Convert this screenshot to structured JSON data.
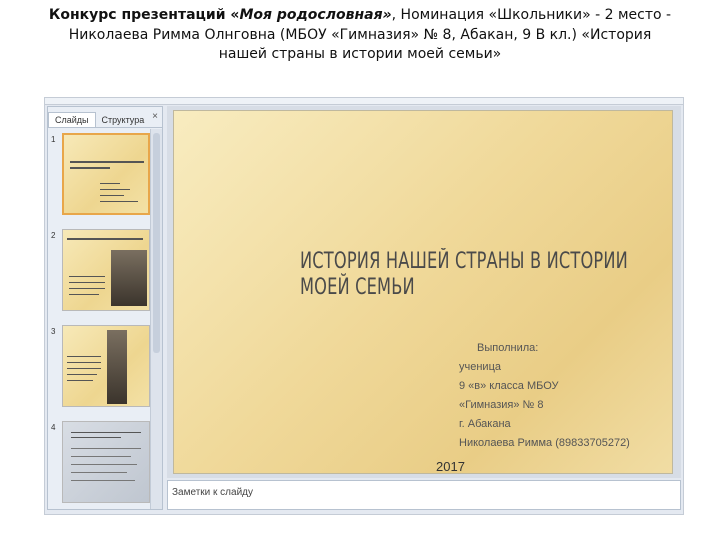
{
  "header": {
    "line1_bold": "Конкурс презентаций «",
    "line1_italic": "Моя родословная»",
    "line1_rest": ", Номинация «Школьники» - 2 место -",
    "line2": "Николаева Римма Олнговна (МБОУ «Гимназия» № 8, Абакан, 9 В кл.) «История",
    "line3": "нашей страны в истории моей семьи»"
  },
  "panel": {
    "tabs": [
      {
        "label": "Слайды"
      },
      {
        "label": "Структура"
      }
    ],
    "close_glyph": "×",
    "thumbnails": [
      {
        "number": "1"
      },
      {
        "number": "2"
      },
      {
        "number": "3"
      },
      {
        "number": "4"
      }
    ]
  },
  "slide": {
    "title": "История нашей страны в истории моей семьи",
    "body_lines": [
      "Выполнила:",
      "ученица",
      "9 «в» класса МБОУ",
      "«Гимназия» № 8",
      "г. Абакана",
      "Николаева Римма (89833705272)"
    ],
    "year": "2017"
  },
  "notes": {
    "placeholder": "Заметки к слайду"
  },
  "colors": {
    "slide_gradient_start": "#f8ecc0",
    "slide_gradient_end": "#e9cd86",
    "selection": "#e8a64a"
  }
}
